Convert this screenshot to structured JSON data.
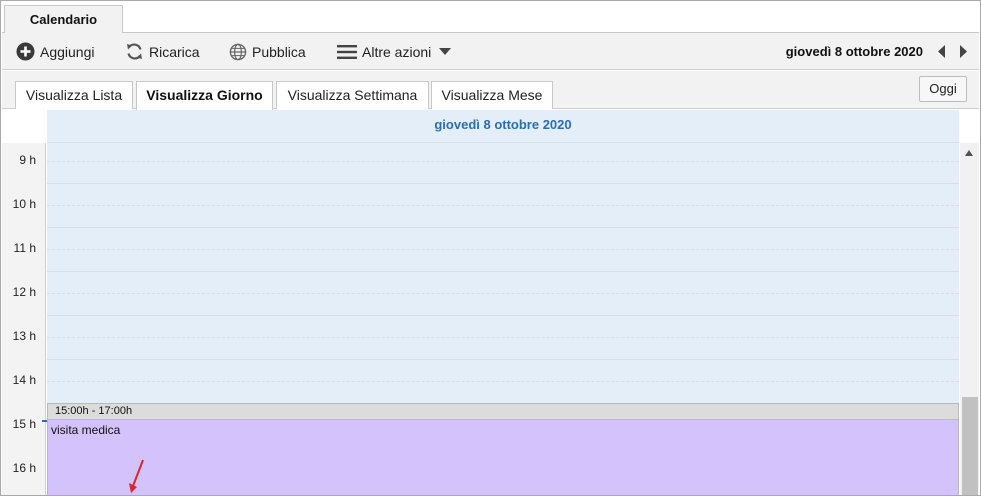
{
  "app": {
    "tab_label": "Calendario"
  },
  "toolbar": {
    "add_label": "Aggiungi",
    "reload_label": "Ricarica",
    "publish_label": "Pubblica",
    "more_label": "Altre azioni",
    "current_date": "giovedì 8 ottobre 2020"
  },
  "views": {
    "list": "Visualizza Lista",
    "day": "Visualizza Giorno",
    "week": "Visualizza Settimana",
    "month": "Visualizza Mese",
    "active": "day",
    "today_label": "Oggi"
  },
  "day_view": {
    "header": "giovedì 8 ottobre 2020",
    "hours": [
      "9 h",
      "10 h",
      "11 h",
      "12 h",
      "13 h",
      "14 h",
      "15 h",
      "16 h"
    ]
  },
  "event": {
    "time": "15:00h - 17:00h",
    "title": "visita medica",
    "color": "#d4c2fc"
  },
  "colors": {
    "accent": "#2a6fad",
    "grid_bg": "#e4eef8",
    "annotation_arrow": "#d9262b"
  }
}
